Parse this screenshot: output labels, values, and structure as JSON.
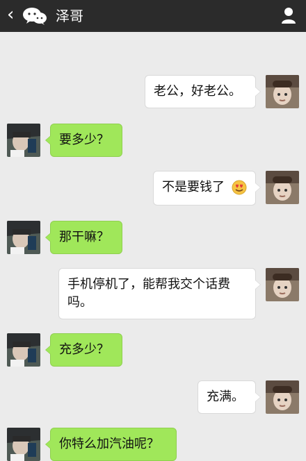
{
  "header": {
    "back_glyph": "‹",
    "title": "泽哥"
  },
  "messages": [
    {
      "side": "right",
      "text": "老公，好老公。"
    },
    {
      "side": "left",
      "text": "要多少？"
    },
    {
      "side": "right",
      "text": "不是要钱了",
      "emoji": "smiling-face-with-heart-eyes"
    },
    {
      "side": "left",
      "text": "那干嘛？"
    },
    {
      "side": "right",
      "text": "手机停机了，能帮我交个话费吗。"
    },
    {
      "side": "left",
      "text": "充多少？"
    },
    {
      "side": "right",
      "text": "充满。"
    },
    {
      "side": "left",
      "text": "你特么加汽油呢？"
    }
  ],
  "colors": {
    "topbar": "#2b2b2b",
    "background": "#ebebeb",
    "left_bubble": "#a0e75a",
    "right_bubble": "#ffffff"
  }
}
